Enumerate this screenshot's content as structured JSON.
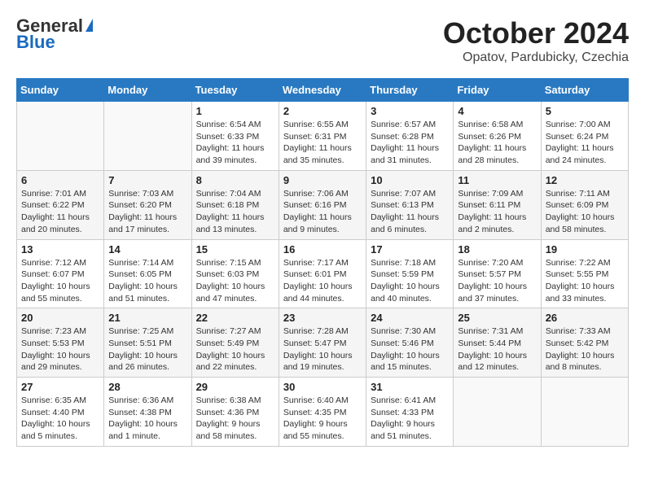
{
  "logo": {
    "general": "General",
    "blue": "Blue"
  },
  "title": "October 2024",
  "location": "Opatov, Pardubicky, Czechia",
  "days_of_week": [
    "Sunday",
    "Monday",
    "Tuesday",
    "Wednesday",
    "Thursday",
    "Friday",
    "Saturday"
  ],
  "weeks": [
    [
      {
        "day": "",
        "sunrise": "",
        "sunset": "",
        "daylight": ""
      },
      {
        "day": "",
        "sunrise": "",
        "sunset": "",
        "daylight": ""
      },
      {
        "day": "1",
        "sunrise": "Sunrise: 6:54 AM",
        "sunset": "Sunset: 6:33 PM",
        "daylight": "Daylight: 11 hours and 39 minutes."
      },
      {
        "day": "2",
        "sunrise": "Sunrise: 6:55 AM",
        "sunset": "Sunset: 6:31 PM",
        "daylight": "Daylight: 11 hours and 35 minutes."
      },
      {
        "day": "3",
        "sunrise": "Sunrise: 6:57 AM",
        "sunset": "Sunset: 6:28 PM",
        "daylight": "Daylight: 11 hours and 31 minutes."
      },
      {
        "day": "4",
        "sunrise": "Sunrise: 6:58 AM",
        "sunset": "Sunset: 6:26 PM",
        "daylight": "Daylight: 11 hours and 28 minutes."
      },
      {
        "day": "5",
        "sunrise": "Sunrise: 7:00 AM",
        "sunset": "Sunset: 6:24 PM",
        "daylight": "Daylight: 11 hours and 24 minutes."
      }
    ],
    [
      {
        "day": "6",
        "sunrise": "Sunrise: 7:01 AM",
        "sunset": "Sunset: 6:22 PM",
        "daylight": "Daylight: 11 hours and 20 minutes."
      },
      {
        "day": "7",
        "sunrise": "Sunrise: 7:03 AM",
        "sunset": "Sunset: 6:20 PM",
        "daylight": "Daylight: 11 hours and 17 minutes."
      },
      {
        "day": "8",
        "sunrise": "Sunrise: 7:04 AM",
        "sunset": "Sunset: 6:18 PM",
        "daylight": "Daylight: 11 hours and 13 minutes."
      },
      {
        "day": "9",
        "sunrise": "Sunrise: 7:06 AM",
        "sunset": "Sunset: 6:16 PM",
        "daylight": "Daylight: 11 hours and 9 minutes."
      },
      {
        "day": "10",
        "sunrise": "Sunrise: 7:07 AM",
        "sunset": "Sunset: 6:13 PM",
        "daylight": "Daylight: 11 hours and 6 minutes."
      },
      {
        "day": "11",
        "sunrise": "Sunrise: 7:09 AM",
        "sunset": "Sunset: 6:11 PM",
        "daylight": "Daylight: 11 hours and 2 minutes."
      },
      {
        "day": "12",
        "sunrise": "Sunrise: 7:11 AM",
        "sunset": "Sunset: 6:09 PM",
        "daylight": "Daylight: 10 hours and 58 minutes."
      }
    ],
    [
      {
        "day": "13",
        "sunrise": "Sunrise: 7:12 AM",
        "sunset": "Sunset: 6:07 PM",
        "daylight": "Daylight: 10 hours and 55 minutes."
      },
      {
        "day": "14",
        "sunrise": "Sunrise: 7:14 AM",
        "sunset": "Sunset: 6:05 PM",
        "daylight": "Daylight: 10 hours and 51 minutes."
      },
      {
        "day": "15",
        "sunrise": "Sunrise: 7:15 AM",
        "sunset": "Sunset: 6:03 PM",
        "daylight": "Daylight: 10 hours and 47 minutes."
      },
      {
        "day": "16",
        "sunrise": "Sunrise: 7:17 AM",
        "sunset": "Sunset: 6:01 PM",
        "daylight": "Daylight: 10 hours and 44 minutes."
      },
      {
        "day": "17",
        "sunrise": "Sunrise: 7:18 AM",
        "sunset": "Sunset: 5:59 PM",
        "daylight": "Daylight: 10 hours and 40 minutes."
      },
      {
        "day": "18",
        "sunrise": "Sunrise: 7:20 AM",
        "sunset": "Sunset: 5:57 PM",
        "daylight": "Daylight: 10 hours and 37 minutes."
      },
      {
        "day": "19",
        "sunrise": "Sunrise: 7:22 AM",
        "sunset": "Sunset: 5:55 PM",
        "daylight": "Daylight: 10 hours and 33 minutes."
      }
    ],
    [
      {
        "day": "20",
        "sunrise": "Sunrise: 7:23 AM",
        "sunset": "Sunset: 5:53 PM",
        "daylight": "Daylight: 10 hours and 29 minutes."
      },
      {
        "day": "21",
        "sunrise": "Sunrise: 7:25 AM",
        "sunset": "Sunset: 5:51 PM",
        "daylight": "Daylight: 10 hours and 26 minutes."
      },
      {
        "day": "22",
        "sunrise": "Sunrise: 7:27 AM",
        "sunset": "Sunset: 5:49 PM",
        "daylight": "Daylight: 10 hours and 22 minutes."
      },
      {
        "day": "23",
        "sunrise": "Sunrise: 7:28 AM",
        "sunset": "Sunset: 5:47 PM",
        "daylight": "Daylight: 10 hours and 19 minutes."
      },
      {
        "day": "24",
        "sunrise": "Sunrise: 7:30 AM",
        "sunset": "Sunset: 5:46 PM",
        "daylight": "Daylight: 10 hours and 15 minutes."
      },
      {
        "day": "25",
        "sunrise": "Sunrise: 7:31 AM",
        "sunset": "Sunset: 5:44 PM",
        "daylight": "Daylight: 10 hours and 12 minutes."
      },
      {
        "day": "26",
        "sunrise": "Sunrise: 7:33 AM",
        "sunset": "Sunset: 5:42 PM",
        "daylight": "Daylight: 10 hours and 8 minutes."
      }
    ],
    [
      {
        "day": "27",
        "sunrise": "Sunrise: 6:35 AM",
        "sunset": "Sunset: 4:40 PM",
        "daylight": "Daylight: 10 hours and 5 minutes."
      },
      {
        "day": "28",
        "sunrise": "Sunrise: 6:36 AM",
        "sunset": "Sunset: 4:38 PM",
        "daylight": "Daylight: 10 hours and 1 minute."
      },
      {
        "day": "29",
        "sunrise": "Sunrise: 6:38 AM",
        "sunset": "Sunset: 4:36 PM",
        "daylight": "Daylight: 9 hours and 58 minutes."
      },
      {
        "day": "30",
        "sunrise": "Sunrise: 6:40 AM",
        "sunset": "Sunset: 4:35 PM",
        "daylight": "Daylight: 9 hours and 55 minutes."
      },
      {
        "day": "31",
        "sunrise": "Sunrise: 6:41 AM",
        "sunset": "Sunset: 4:33 PM",
        "daylight": "Daylight: 9 hours and 51 minutes."
      },
      {
        "day": "",
        "sunrise": "",
        "sunset": "",
        "daylight": ""
      },
      {
        "day": "",
        "sunrise": "",
        "sunset": "",
        "daylight": ""
      }
    ]
  ]
}
